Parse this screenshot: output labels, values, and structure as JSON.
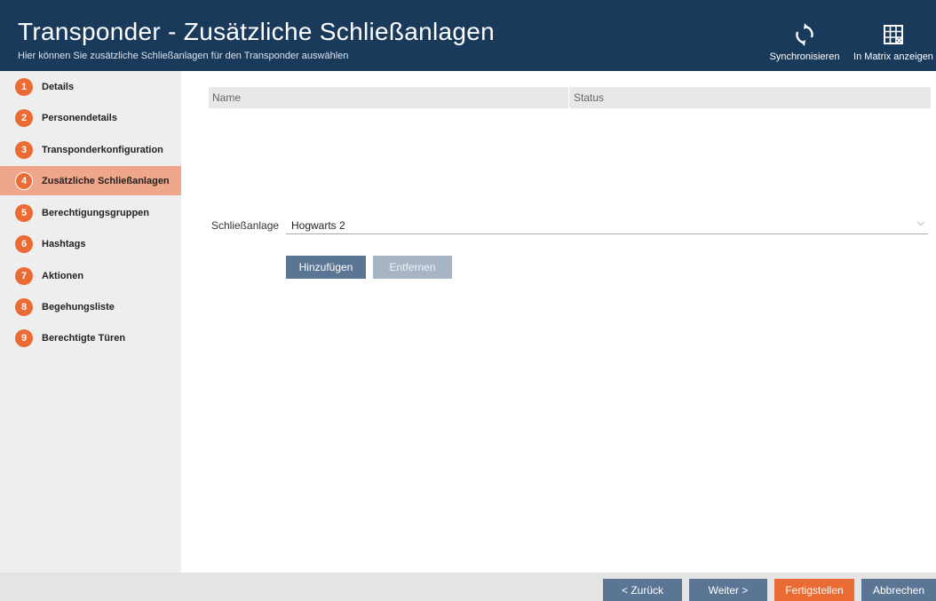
{
  "header": {
    "title": "Transponder - Zusätzliche Schließanlagen",
    "subtitle": "Hier können Sie zusätzliche Schließanlagen für den Transponder auswählen",
    "sync_label": "Synchronisieren",
    "matrix_label": "In Matrix anzeigen",
    "sync_icon": "sync-icon",
    "matrix_icon": "matrix-icon"
  },
  "sidebar": {
    "steps": [
      {
        "num": "1",
        "label": "Details"
      },
      {
        "num": "2",
        "label": "Personendetails"
      },
      {
        "num": "3",
        "label": "Transponderkonfiguration"
      },
      {
        "num": "4",
        "label": "Zusätzliche Schließanlagen",
        "active": true
      },
      {
        "num": "5",
        "label": "Berechtigungsgruppen"
      },
      {
        "num": "6",
        "label": "Hashtags"
      },
      {
        "num": "7",
        "label": "Aktionen"
      },
      {
        "num": "8",
        "label": "Begehungsliste"
      },
      {
        "num": "9",
        "label": "Berechtigte Türen"
      }
    ]
  },
  "table": {
    "columns": [
      "Name",
      "Status"
    ],
    "rows": []
  },
  "form": {
    "label": "Schließanlage",
    "value": "Hogwarts 2",
    "add_label": "Hinzufügen",
    "remove_label": "Entfernen"
  },
  "footer": {
    "back_label": "< Zurück",
    "next_label": "Weiter >",
    "finish_label": "Fertigstellen",
    "cancel_label": "Abbrechen"
  },
  "colors": {
    "header_bg": "#1a3a5c",
    "accent": "#ea6b33",
    "button": "#5b7694"
  }
}
